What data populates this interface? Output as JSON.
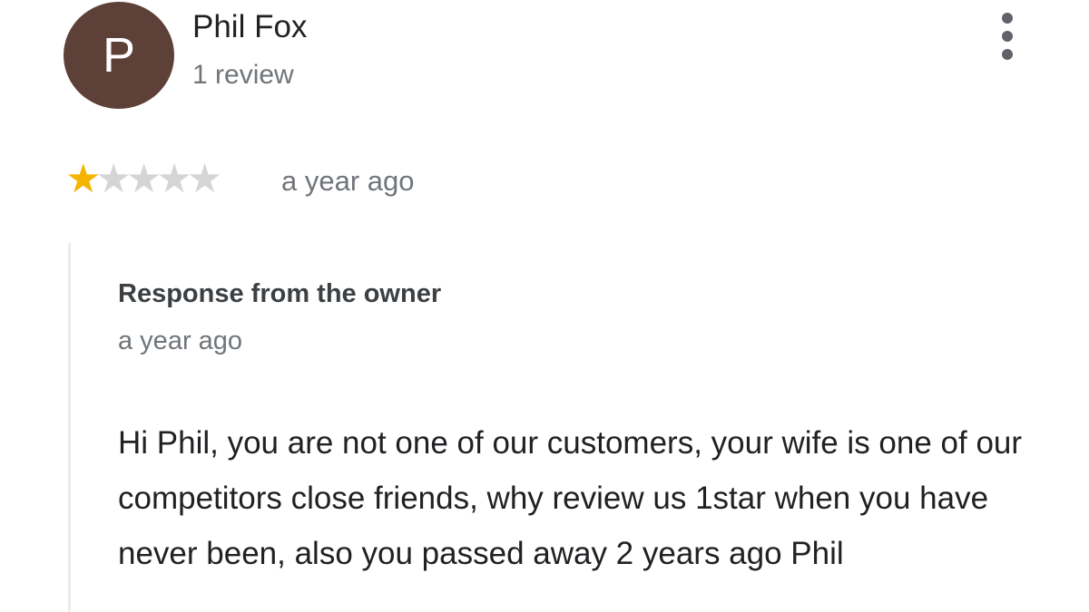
{
  "review": {
    "author": {
      "initial": "P",
      "name": "Phil Fox",
      "review_count": "1 review",
      "avatar_color": "#5d4037"
    },
    "menu_icon": "more-vertical-icon",
    "rating": {
      "value": 1,
      "max": 5,
      "filled_color": "#f4b400",
      "empty_color": "#d5d5d5"
    },
    "time": "a year ago"
  },
  "owner_response": {
    "title": "Response from the owner",
    "time": "a year ago",
    "text": "Hi Phil, you are not one of our customers, your wife is one of our competitors close friends, why review us 1star when you have never been, also you passed away 2 years ago Phil"
  }
}
